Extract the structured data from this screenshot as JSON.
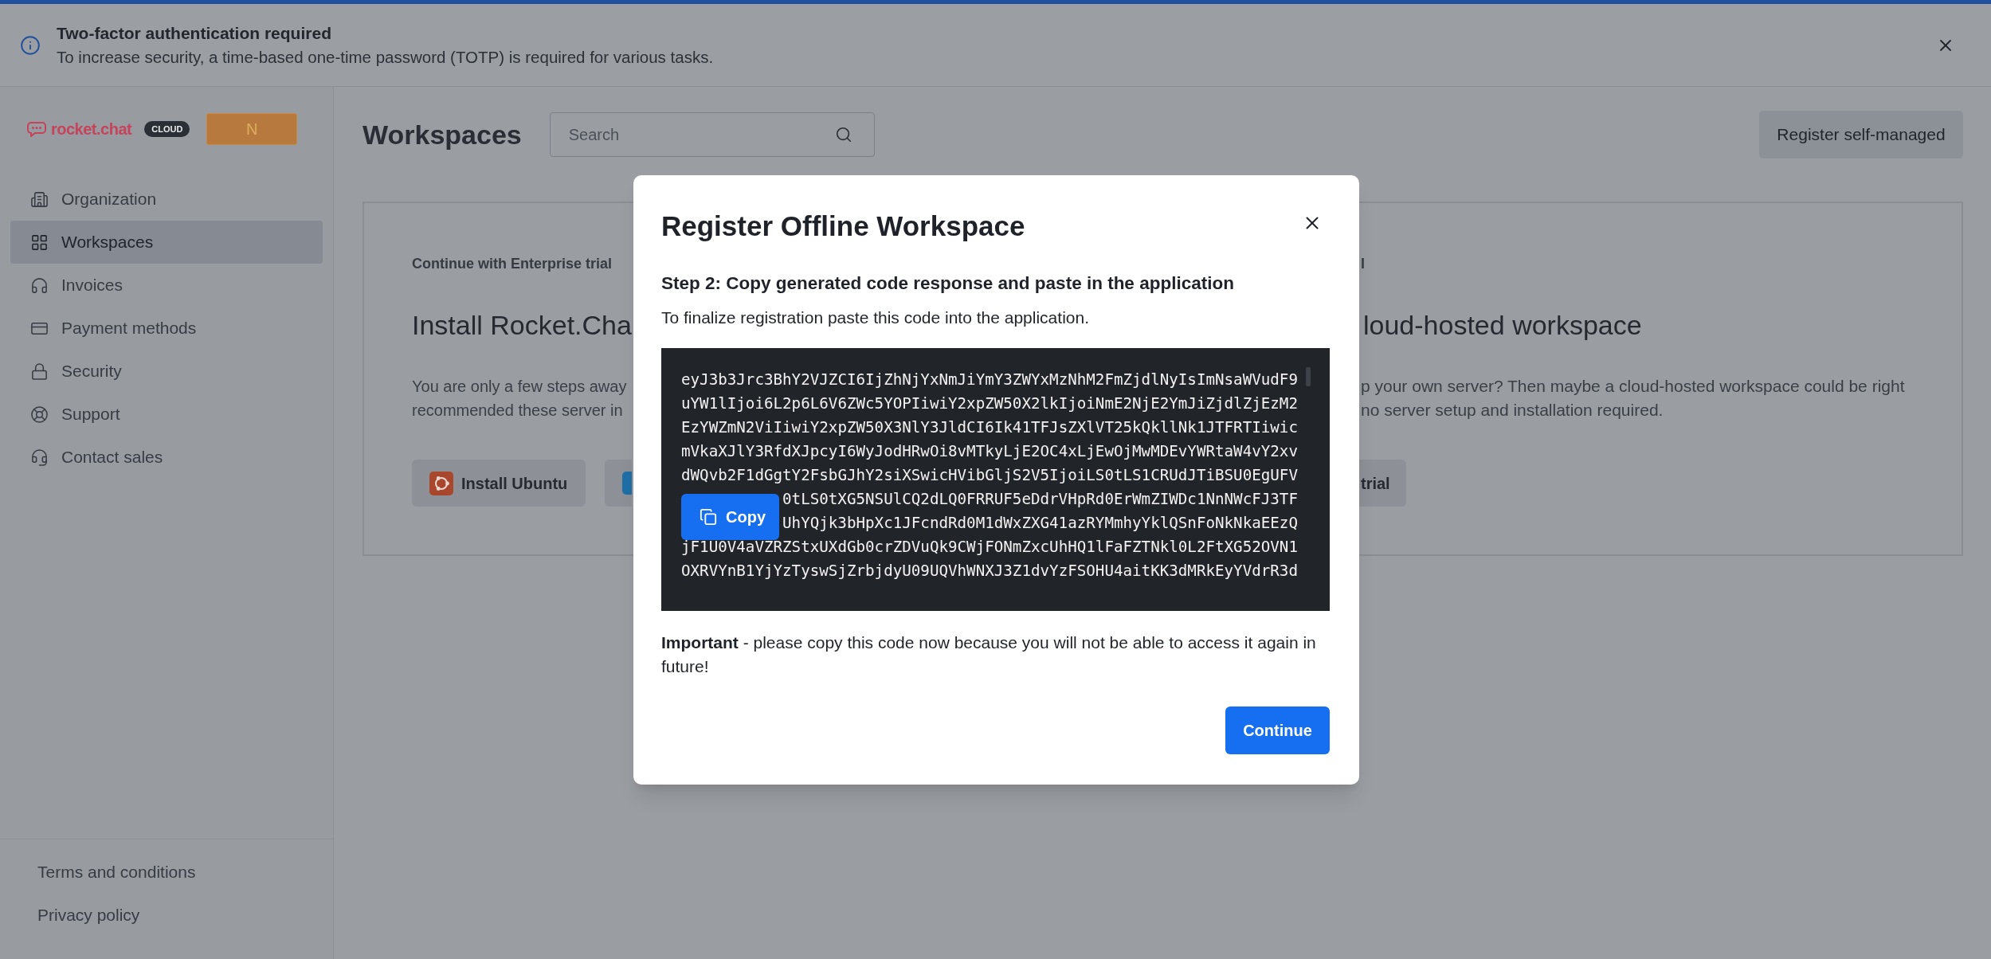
{
  "banner": {
    "title": "Two-factor authentication required",
    "message": "To increase security, a time-based one-time password (TOTP) is required for various tasks."
  },
  "sidebar": {
    "logo_text": "rocket.chat",
    "badge": "CLOUD",
    "avatar_letter": "N",
    "items": [
      {
        "label": "Organization",
        "selected": false
      },
      {
        "label": "Workspaces",
        "selected": true
      },
      {
        "label": "Invoices",
        "selected": false
      },
      {
        "label": "Payment methods",
        "selected": false
      },
      {
        "label": "Security",
        "selected": false
      },
      {
        "label": "Support",
        "selected": false
      },
      {
        "label": "Contact sales",
        "selected": false
      }
    ],
    "footer_links": [
      "Terms and conditions",
      "Privacy policy"
    ]
  },
  "main": {
    "title": "Workspaces",
    "search": {
      "placeholder": "Search"
    },
    "register_button": "Register self-managed",
    "options": [
      {
        "label": "Continue with Enterprise trial",
        "title": "Install Rocket.Cha",
        "description": [
          "You are only a few steps away",
          "recommended these server in"
        ],
        "buttons": [
          "Install Ubuntu"
        ]
      },
      {
        "label": "l",
        "title": "loud-hosted workspace",
        "description": [
          "p your own server? Then maybe a cloud-hosted workspace could be right",
          "no server setup and installation required."
        ],
        "buttons": [
          "trial"
        ]
      }
    ]
  },
  "dialog": {
    "title": "Register Offline Workspace",
    "step_title": "Step 2: Copy generated code response and paste in the application",
    "instruction": "To finalize registration paste this code into the application.",
    "code_lines": [
      "eyJ3b3Jrc3BhY2VJZCI6IjZhNjYxNmJiYmY3ZWYxMzNhM2FmZjdlNyIsImNsaWVudF9",
      "uYW1lIjoi6L2p6L6V6ZWc5YOPIiwiY2xpZW50X2lkIjoiNmE2NjE2YmJiZjdlZjEzM2",
      "EzYWZmN2ViIiwiY2xpZW50X3NlY3JldCI6Ik41TFJsZXlVT25kQkllNk1JTFRTIiwic",
      "mVkaXJlY3RfdXJpcyI6WyJodHRwOi8vMTkyLjE2OC4xLjEwOjMwMDEvYWRtaW4vY2xv",
      "dWQvb2F1dGgtY2FsbGJhY2siXSwicHVibGljS2V5IjoiLS0tLS1CRUdJTiBSU0EgUFV",
      "0tLS0tXG5NSUlCQ2dLQ0FRRUF5eDdrVHpRd0ErWmZIWDc1NnNWcFJ3TF",
      "UhYQjk3bHpXc1JFcndRd0M1dWxZXG41azRYMmhyYklQSnFoNkNkaEEzQ",
      "jF1U0V4aVZRZStxUXdGb0crZDVuQk9CWjFONmZxcUhHQ1lFaFZTNkl0L2FtXG52OVN1",
      "OXRVYnB1YjYzTyswSjZrbjdyU09UQVhWNXJ3Z1dvYzFSOHU4aitKK3dMRkEyYVdrR3d"
    ],
    "copy_button": "Copy",
    "note": "**Important** - please copy this code now because you will not be able to access it again in future!",
    "continue_button": "Continue"
  }
}
